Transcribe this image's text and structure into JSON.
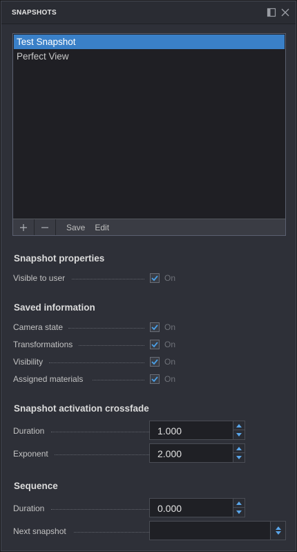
{
  "panel": {
    "title": "SNAPSHOTS"
  },
  "snapshots": {
    "items": [
      {
        "label": "Test Snapshot",
        "selected": true
      },
      {
        "label": "Perfect View",
        "selected": false
      }
    ],
    "footer": {
      "save_label": "Save",
      "edit_label": "Edit"
    }
  },
  "properties": {
    "title": "Snapshot properties",
    "visible_to_user": {
      "label": "Visible to user",
      "checked": true,
      "state": "On"
    }
  },
  "saved_information": {
    "title": "Saved information",
    "items": [
      {
        "label": "Camera state",
        "checked": true,
        "state": "On"
      },
      {
        "label": "Transformations",
        "checked": true,
        "state": "On"
      },
      {
        "label": "Visibility",
        "checked": true,
        "state": "On"
      },
      {
        "label": "Assigned materials",
        "checked": true,
        "state": "On"
      }
    ]
  },
  "crossfade": {
    "title": "Snapshot activation crossfade",
    "duration": {
      "label": "Duration",
      "value": "1.000"
    },
    "exponent": {
      "label": "Exponent",
      "value": "2.000"
    }
  },
  "sequence": {
    "title": "Sequence",
    "duration": {
      "label": "Duration",
      "value": "0.000"
    },
    "next_snapshot": {
      "label": "Next snapshot",
      "value": ""
    }
  },
  "colors": {
    "accent": "#3a80c8",
    "panel_bg": "#2e3038",
    "list_bg": "#1f1f24",
    "check_color": "#4aa0e8"
  },
  "icons": {
    "float": "float-window-icon",
    "close": "close-icon",
    "add": "plus-icon",
    "remove": "minus-icon",
    "check": "checkmark-icon",
    "spin_up": "arrow-up-icon",
    "spin_down": "arrow-down-icon",
    "dropdown": "dropdown-arrows-icon"
  }
}
